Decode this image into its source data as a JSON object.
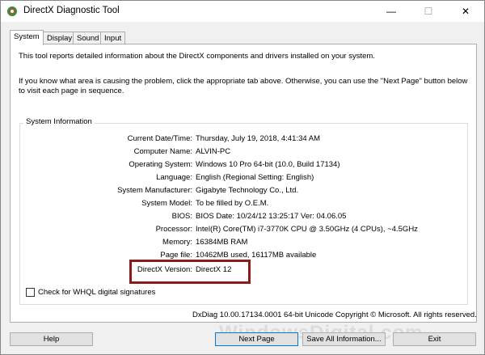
{
  "window": {
    "title": "DirectX Diagnostic Tool",
    "controls": {
      "minimize": "—",
      "maximize": "☐",
      "close": "✕"
    }
  },
  "tabs": [
    {
      "label": "System",
      "active": true
    },
    {
      "label": "Display",
      "active": false
    },
    {
      "label": "Sound",
      "active": false
    },
    {
      "label": "Input",
      "active": false
    }
  ],
  "intro": {
    "line1": "This tool reports detailed information about the DirectX components and drivers installed on your system.",
    "line2": "If you know what area is causing the problem, click the appropriate tab above.  Otherwise, you can use the \"Next Page\" button below to visit each page in sequence."
  },
  "system_info": {
    "group_label": "System Information",
    "rows": [
      {
        "label": "Current Date/Time:",
        "value": "Thursday, July 19, 2018, 4:41:34 AM"
      },
      {
        "label": "Computer Name:",
        "value": "ALVIN-PC"
      },
      {
        "label": "Operating System:",
        "value": "Windows 10 Pro 64-bit (10.0, Build 17134)"
      },
      {
        "label": "Language:",
        "value": "English (Regional Setting: English)"
      },
      {
        "label": "System Manufacturer:",
        "value": "Gigabyte Technology Co., Ltd."
      },
      {
        "label": "System Model:",
        "value": "To be filled by O.E.M."
      },
      {
        "label": "BIOS:",
        "value": "BIOS Date: 10/24/12 13:25:17 Ver: 04.06.05"
      },
      {
        "label": "Processor:",
        "value": "Intel(R) Core(TM) i7-3770K CPU @ 3.50GHz (4 CPUs), ~4.5GHz"
      },
      {
        "label": "Memory:",
        "value": "16384MB RAM"
      },
      {
        "label": "Page file:",
        "value": "10462MB used, 16117MB available"
      },
      {
        "label": "DirectX Version:",
        "value": "DirectX 12"
      }
    ]
  },
  "whql_checkbox": {
    "label": "Check for WHQL digital signatures",
    "checked": false
  },
  "footer_info": "DxDiag 10.00.17134.0001 64-bit Unicode  Copyright © Microsoft. All rights reserved.",
  "buttons": {
    "help": "Help",
    "next_page": "Next Page",
    "save_all": "Save All Information...",
    "exit": "Exit"
  },
  "watermark": "WindowsDigital.com",
  "colors": {
    "highlight_box": "#8b1a1a",
    "focus_border": "#0078d7"
  }
}
